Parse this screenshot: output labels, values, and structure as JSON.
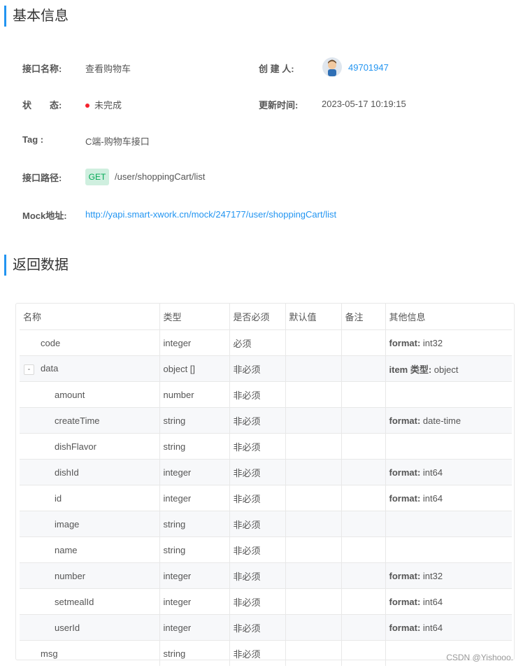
{
  "basic_info": {
    "title": "基本信息",
    "interface_name_label": "接口名称:",
    "interface_name_value": "查看购物车",
    "creator_label": "创 建 人:",
    "creator_value": "49701947",
    "status_label": "状　　态:",
    "status_value": "未完成",
    "status_color": "#f5222d",
    "update_time_label": "更新时间:",
    "update_time_value": "2023-05-17 10:19:15",
    "tag_label": "Tag :",
    "tag_value": "C端-购物车接口",
    "path_label": "接口路径:",
    "method": "GET",
    "path_value": "/user/shoppingCart/list",
    "mock_label": "Mock地址:",
    "mock_value": "http://yapi.smart-xwork.cn/mock/247177/user/shoppingCart/list"
  },
  "response": {
    "title": "返回数据",
    "columns": [
      "名称",
      "类型",
      "是否必须",
      "默认值",
      "备注",
      "其他信息"
    ],
    "rows": [
      {
        "name": "code",
        "type": "integer",
        "required": "必须",
        "default": "",
        "remark": "",
        "info_key": "format:",
        "info_value": "int32",
        "level": 1
      },
      {
        "name": "data",
        "type": "object []",
        "required": "非必须",
        "default": "",
        "remark": "",
        "info_key": "item 类型:",
        "info_value": "object",
        "level": 1,
        "toggle": "-"
      },
      {
        "name": "amount",
        "type": "number",
        "required": "非必须",
        "default": "",
        "remark": "",
        "info_key": "",
        "info_value": "",
        "level": 2
      },
      {
        "name": "createTime",
        "type": "string",
        "required": "非必须",
        "default": "",
        "remark": "",
        "info_key": "format:",
        "info_value": "date-time",
        "level": 2
      },
      {
        "name": "dishFlavor",
        "type": "string",
        "required": "非必须",
        "default": "",
        "remark": "",
        "info_key": "",
        "info_value": "",
        "level": 2
      },
      {
        "name": "dishId",
        "type": "integer",
        "required": "非必须",
        "default": "",
        "remark": "",
        "info_key": "format:",
        "info_value": "int64",
        "level": 2
      },
      {
        "name": "id",
        "type": "integer",
        "required": "非必须",
        "default": "",
        "remark": "",
        "info_key": "format:",
        "info_value": "int64",
        "level": 2
      },
      {
        "name": "image",
        "type": "string",
        "required": "非必须",
        "default": "",
        "remark": "",
        "info_key": "",
        "info_value": "",
        "level": 2
      },
      {
        "name": "name",
        "type": "string",
        "required": "非必须",
        "default": "",
        "remark": "",
        "info_key": "",
        "info_value": "",
        "level": 2
      },
      {
        "name": "number",
        "type": "integer",
        "required": "非必须",
        "default": "",
        "remark": "",
        "info_key": "format:",
        "info_value": "int32",
        "level": 2
      },
      {
        "name": "setmealId",
        "type": "integer",
        "required": "非必须",
        "default": "",
        "remark": "",
        "info_key": "format:",
        "info_value": "int64",
        "level": 2
      },
      {
        "name": "userId",
        "type": "integer",
        "required": "非必须",
        "default": "",
        "remark": "",
        "info_key": "format:",
        "info_value": "int64",
        "level": 2
      },
      {
        "name": "msg",
        "type": "string",
        "required": "非必须",
        "default": "",
        "remark": "",
        "info_key": "",
        "info_value": "",
        "level": 1
      }
    ]
  },
  "watermark": "CSDN @Yishooo.",
  "colors": {
    "accent": "#2395f1",
    "get_bg": "#cfefdf",
    "get_text": "#00a854"
  }
}
